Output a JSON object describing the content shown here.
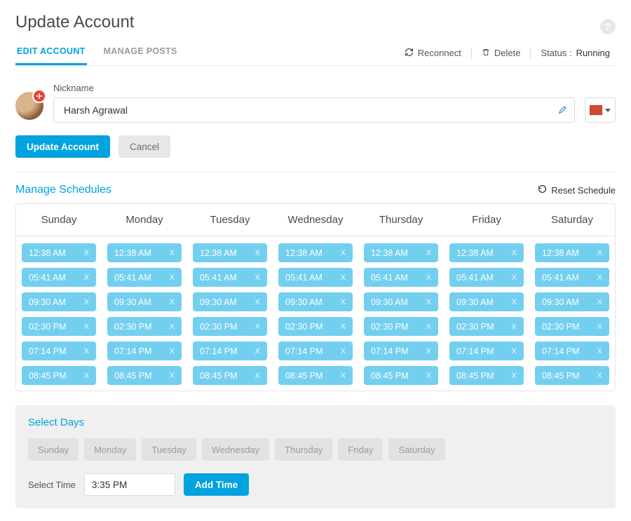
{
  "title": "Update Account",
  "tabs": {
    "edit": "EDIT ACCOUNT",
    "manage": "MANAGE POSTS"
  },
  "actions": {
    "reconnect": "Reconnect",
    "delete": "Delete",
    "status_label": "Status :",
    "status_value": "Running"
  },
  "nickname": {
    "label": "Nickname",
    "value": "Harsh Agrawal"
  },
  "color": "#d64a2b",
  "buttons": {
    "update": "Update Account",
    "cancel": "Cancel"
  },
  "schedules": {
    "title": "Manage Schedules",
    "reset": "Reset Schedule",
    "days": [
      "Sunday",
      "Monday",
      "Tuesday",
      "Wednesday",
      "Thursday",
      "Friday",
      "Saturday"
    ],
    "times": [
      "12:38 AM",
      "05:41 AM",
      "09:30 AM",
      "02:30 PM",
      "07:14 PM",
      "08:45 PM"
    ]
  },
  "select_days": {
    "title": "Select Days",
    "days": [
      "Sunday",
      "Monday",
      "Tuesday",
      "Wednesday",
      "Thursday",
      "Friday",
      "Saturday"
    ],
    "time_label": "Select Time",
    "time_value": "3:35 PM",
    "add_label": "Add Time"
  }
}
